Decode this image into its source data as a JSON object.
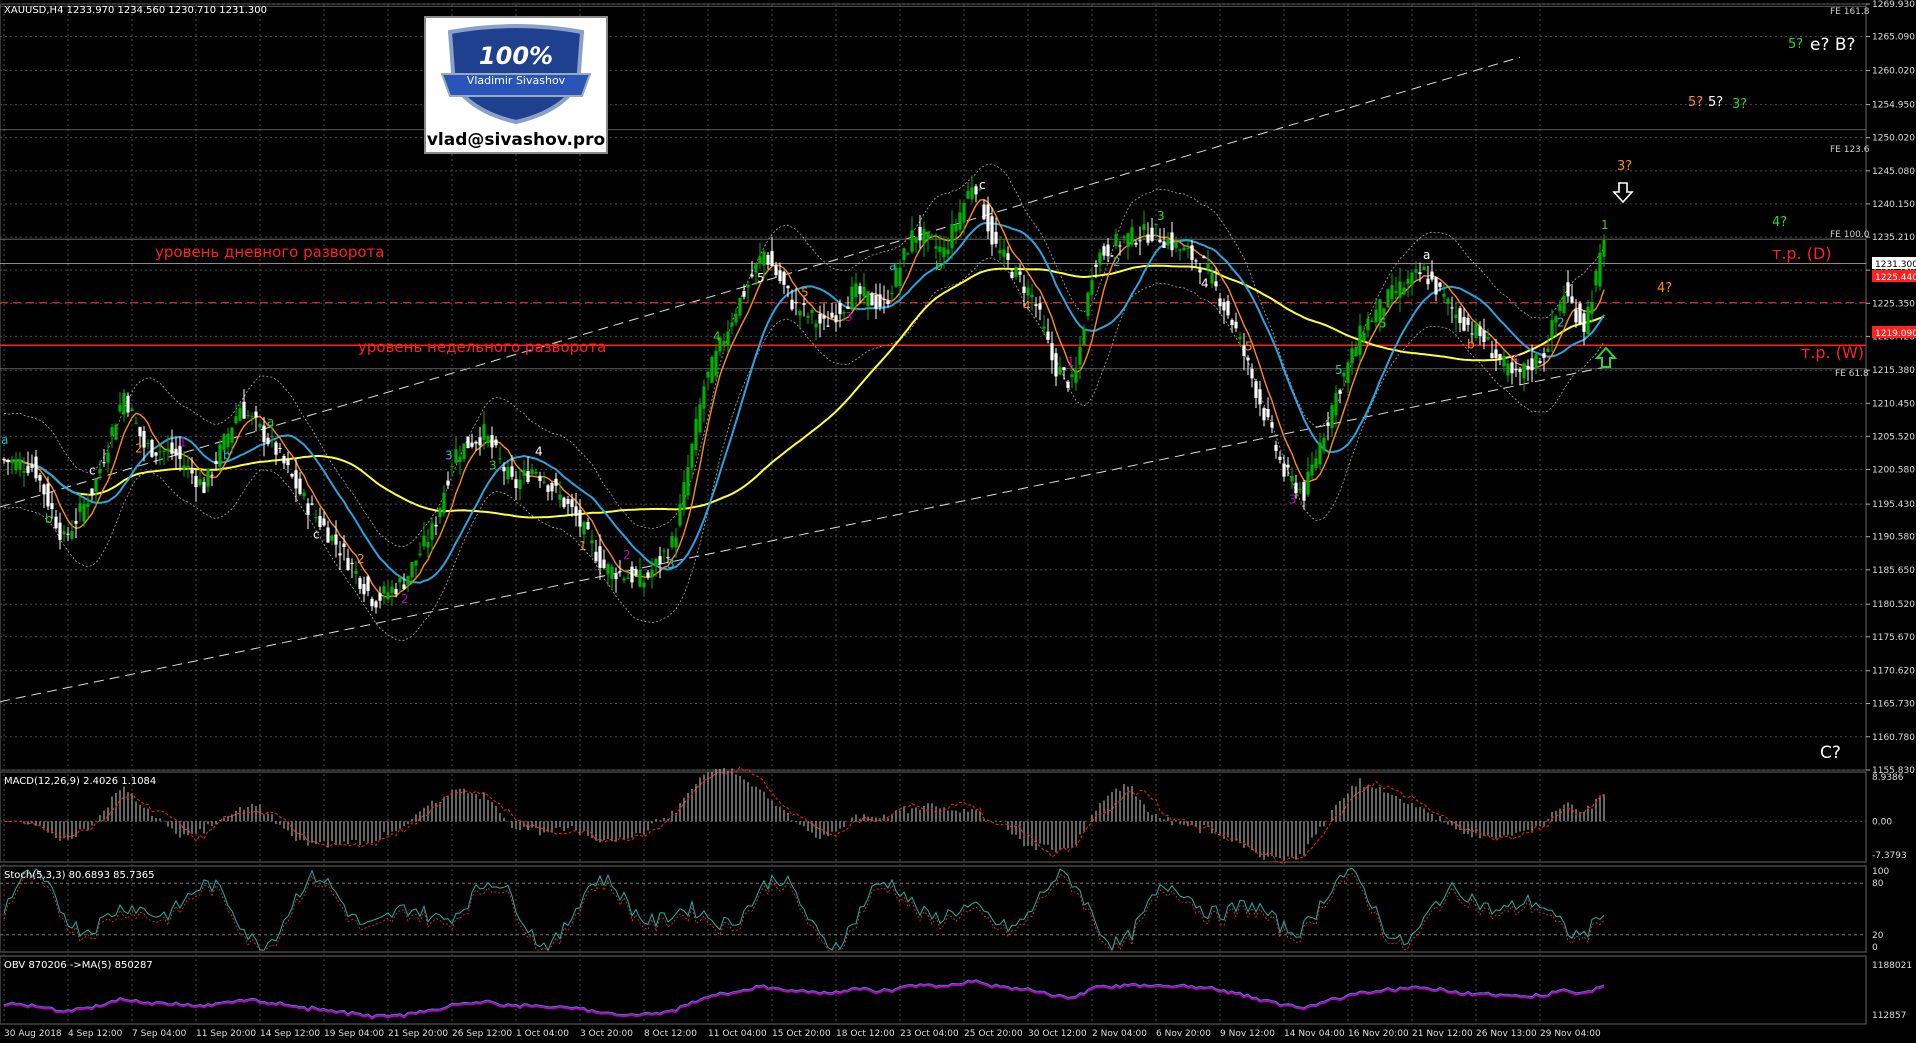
{
  "header": {
    "symbol_info": "XAUUSD,H4  1233.970 1234.560 1230.710 1231.300"
  },
  "logo": {
    "percent": "100%",
    "name": "Vladimir Sivashov",
    "email": "vlad@sivashov.pro"
  },
  "colors": {
    "bg": "#000000",
    "grid": "#4a4a4a",
    "bull": "#00b000",
    "bear": "#ffffff",
    "ma_fast": "#ff8c1a",
    "ma_mid": "#29a3e0",
    "ma_slow": "#ffff33",
    "level": "#ff2020",
    "macd_signal": "#ff2020",
    "stoch_main": "#20b2aa",
    "obv_main": "#c000c0"
  },
  "annotations": {
    "daily_level": "уровень дневного разворота",
    "weekly_level": "уровень недельного разворота",
    "tp_d": "т.р. (D)",
    "tp_w": "т.р. (W)",
    "c_q": "C?",
    "e_q": "e? B?",
    "five_q": "5?",
    "five_q2": "5?",
    "five_q3": "5?",
    "three_q": "3?",
    "three_q2": "3?",
    "four_q": "4?",
    "four_q2": "4?"
  },
  "fe_labels": {
    "fe161": "FE 161.8",
    "fe123": "FE 123.6",
    "fe100": "FE 100.0",
    "fe61": "FE 61.8"
  },
  "price_boxes": {
    "current": "1231.300",
    "daily": "1225.440",
    "weekly": "1219.090"
  },
  "indicators": {
    "macd": "MACD(12,26,9) 2.4026 1.1084",
    "stoch": "Stoch(5,3,3) 80.6893 85.7365",
    "obv": "OBV 870206  ->MA(5) 850287"
  },
  "chart_data": [
    {
      "type": "candlestick",
      "title": "XAUUSD,H4",
      "y_ticks": [
        "1269.930",
        "1265.090",
        "1260.020",
        "1254.950",
        "1250.020",
        "1245.080",
        "1240.150",
        "1235.210",
        "1230.280",
        "1225.350",
        "1220.420",
        "1215.380",
        "1210.450",
        "1205.520",
        "1200.580",
        "1195.430",
        "1190.580",
        "1185.650",
        "1180.520",
        "1175.670",
        "1170.620",
        "1165.730",
        "1160.780",
        "1155.830"
      ],
      "ylim": [
        1155.83,
        1269.93
      ],
      "x_ticks": [
        "30 Aug 2018",
        "4 Sep 12:00",
        "7 Sep 04:00",
        "11 Sep 20:00",
        "14 Sep 12:00",
        "19 Sep 04:00",
        "21 Sep 20:00",
        "26 Sep 12:00",
        "1 Oct 04:00",
        "3 Oct 20:00",
        "8 Oct 12:00",
        "11 Oct 04:00",
        "15 Oct 20:00",
        "18 Oct 12:00",
        "23 Oct 04:00",
        "25 Oct 20:00",
        "30 Oct 12:00",
        "2 Nov 04:00",
        "6 Nov 20:00",
        "9 Nov 12:00",
        "14 Nov 04:00",
        "16 Nov 20:00",
        "21 Nov 12:00",
        "26 Nov 13:00",
        "29 Nov 04:00"
      ],
      "levels": [
        1225.44,
        1219.09
      ],
      "last_price": 1231.3,
      "price_path": [
        [
          0,
          1202
        ],
        [
          15,
          1201
        ],
        [
          30,
          1190
        ],
        [
          45,
          1198
        ],
        [
          60,
          1212
        ],
        [
          70,
          1204
        ],
        [
          85,
          1203
        ],
        [
          100,
          1198
        ],
        [
          118,
          1210
        ],
        [
          135,
          1204
        ],
        [
          150,
          1196
        ],
        [
          170,
          1188
        ],
        [
          185,
          1181
        ],
        [
          200,
          1184
        ],
        [
          215,
          1192
        ],
        [
          225,
          1203
        ],
        [
          240,
          1206
        ],
        [
          255,
          1198
        ],
        [
          265,
          1201
        ],
        [
          285,
          1194
        ],
        [
          300,
          1186
        ],
        [
          320,
          1184
        ],
        [
          335,
          1190
        ],
        [
          350,
          1213
        ],
        [
          365,
          1224
        ],
        [
          380,
          1233
        ],
        [
          395,
          1225
        ],
        [
          410,
          1222
        ],
        [
          425,
          1227
        ],
        [
          440,
          1225
        ],
        [
          455,
          1236
        ],
        [
          470,
          1233
        ],
        [
          485,
          1244
        ],
        [
          495,
          1234
        ],
        [
          505,
          1230
        ],
        [
          515,
          1226
        ],
        [
          525,
          1216
        ],
        [
          535,
          1213
        ],
        [
          545,
          1232
        ],
        [
          560,
          1235
        ],
        [
          575,
          1236
        ],
        [
          590,
          1233
        ],
        [
          600,
          1231
        ],
        [
          615,
          1222
        ],
        [
          630,
          1209
        ],
        [
          640,
          1200
        ],
        [
          650,
          1197
        ],
        [
          665,
          1211
        ],
        [
          680,
          1222
        ],
        [
          695,
          1227
        ],
        [
          710,
          1230
        ],
        [
          725,
          1224
        ],
        [
          740,
          1220
        ],
        [
          755,
          1214
        ],
        [
          770,
          1218
        ],
        [
          780,
          1227
        ],
        [
          790,
          1222
        ],
        [
          800,
          1234
        ]
      ],
      "wave_labels": [
        "a",
        "b",
        "c",
        "2",
        "1",
        "b",
        "a",
        "c",
        "2",
        "2",
        "3",
        "3",
        "4",
        "1",
        "2",
        "3",
        "4",
        "5",
        "5",
        "3",
        "a",
        "b",
        "c",
        "4",
        "1",
        "2",
        "3",
        "4",
        "5",
        "3",
        "5",
        "5",
        "a",
        "b",
        "c",
        "2",
        "1"
      ]
    },
    {
      "type": "bar",
      "title": "MACD(12,26,9)",
      "y_ticks": [
        "8.9386",
        "0.00",
        "-7.3793"
      ],
      "ylim": [
        -7.3793,
        8.9386
      ],
      "last": [
        2.4026,
        1.1084
      ]
    },
    {
      "type": "line",
      "title": "Stoch(5,3,3)",
      "y_ticks": [
        "100",
        "80",
        "20",
        "0"
      ],
      "ylim": [
        0,
        100
      ],
      "last": [
        80.6893,
        85.7365
      ]
    },
    {
      "type": "line",
      "title": "OBV",
      "y_ticks": [
        "1188021",
        "112857"
      ],
      "last": [
        870206,
        850287
      ]
    }
  ]
}
